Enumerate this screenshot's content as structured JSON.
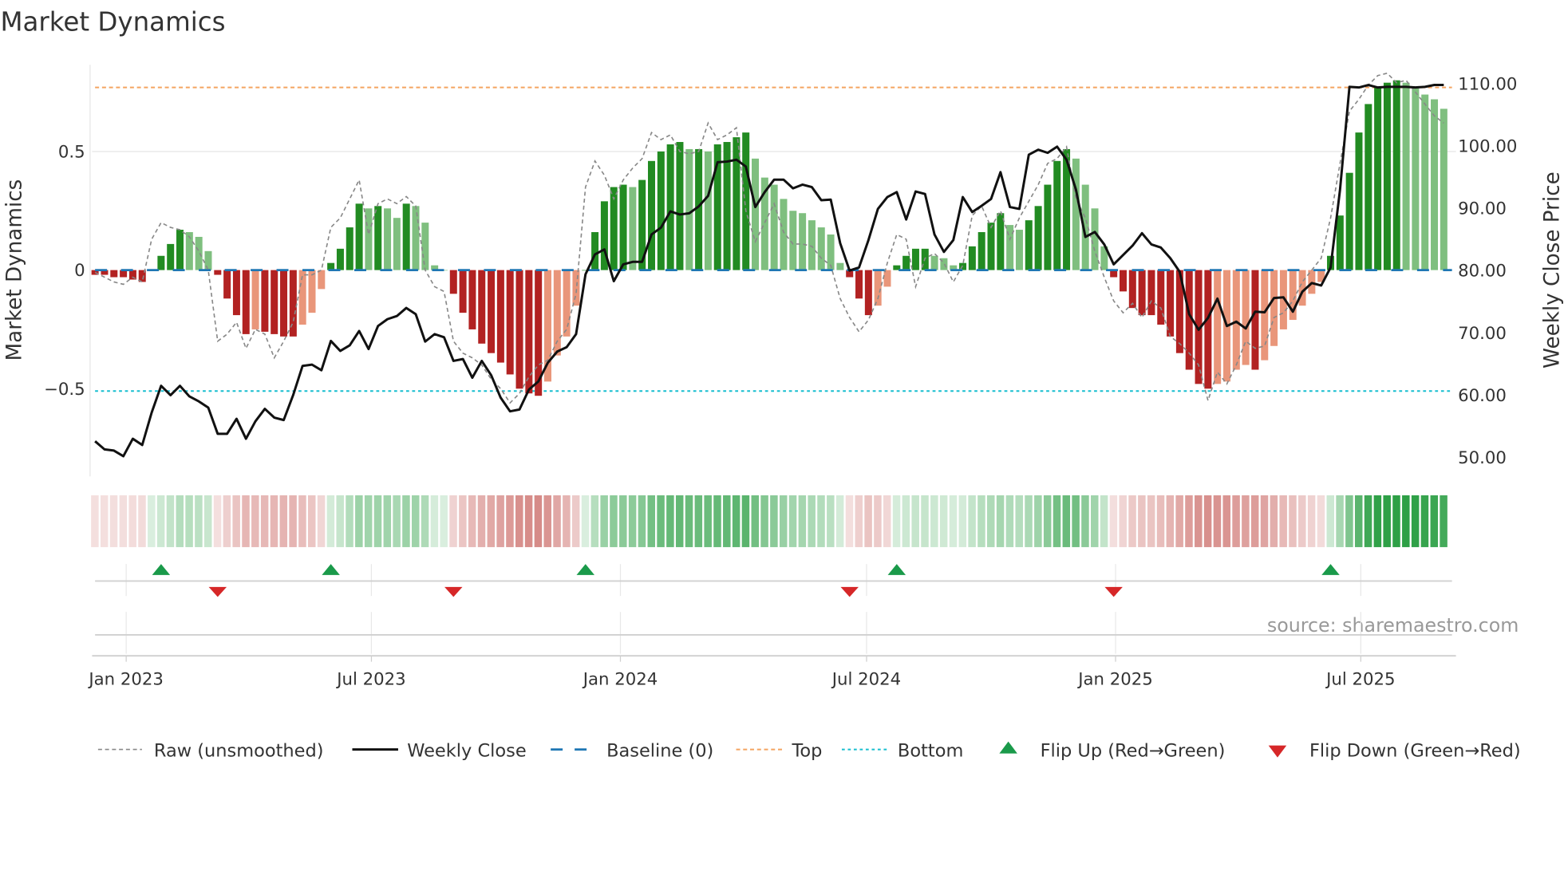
{
  "chart_data": {
    "type": "bar",
    "title": "Market Dynamics",
    "ylabel": "Market Dynamics",
    "y2label": "Weekly Close Price",
    "ylim": [
      -0.87,
      0.87
    ],
    "y2lim": [
      45,
      114
    ],
    "yticks": [
      {
        "v": 0.5,
        "label": "0.5"
      },
      {
        "v": 0,
        "label": "0"
      },
      {
        "v": -0.5,
        "label": "−0.5"
      }
    ],
    "y2ticks": [
      {
        "v": 110,
        "label": "110.00"
      },
      {
        "v": 100,
        "label": "100.00"
      },
      {
        "v": 90,
        "label": "90.00"
      },
      {
        "v": 80,
        "label": "80.00"
      },
      {
        "v": 70,
        "label": "70.00"
      },
      {
        "v": 60,
        "label": "60.00"
      },
      {
        "v": 50,
        "label": "50.00"
      }
    ],
    "xticks": [
      {
        "week": 3.3,
        "label": "Jan 2023"
      },
      {
        "week": 29.3,
        "label": "Jul 2023"
      },
      {
        "week": 55.7,
        "label": "Jan 2024"
      },
      {
        "week": 81.8,
        "label": "Jul 2024"
      },
      {
        "week": 108.2,
        "label": "Jan 2025"
      },
      {
        "week": 134.2,
        "label": "Jul 2025"
      }
    ],
    "top": 0.77,
    "bottom": -0.51,
    "momentum": [
      -0.02,
      -0.02,
      -0.03,
      -0.03,
      -0.04,
      -0.05,
      0.0,
      0.06,
      0.11,
      0.17,
      0.16,
      0.14,
      0.08,
      -0.02,
      -0.12,
      -0.19,
      -0.27,
      -0.25,
      -0.26,
      -0.27,
      -0.28,
      -0.28,
      -0.23,
      -0.18,
      -0.08,
      0.03,
      0.09,
      0.18,
      0.28,
      0.26,
      0.27,
      0.26,
      0.22,
      0.28,
      0.27,
      0.2,
      0.02,
      0.0,
      -0.1,
      -0.18,
      -0.25,
      -0.31,
      -0.35,
      -0.39,
      -0.44,
      -0.5,
      -0.52,
      -0.53,
      -0.47,
      -0.36,
      -0.28,
      -0.15,
      0.0,
      0.16,
      0.29,
      0.35,
      0.36,
      0.35,
      0.38,
      0.46,
      0.5,
      0.53,
      0.54,
      0.51,
      0.51,
      0.5,
      0.53,
      0.54,
      0.56,
      0.58,
      0.47,
      0.39,
      0.36,
      0.3,
      0.25,
      0.24,
      0.21,
      0.18,
      0.15,
      0.03,
      -0.03,
      -0.12,
      -0.19,
      -0.15,
      -0.07,
      0.02,
      0.06,
      0.09,
      0.09,
      0.06,
      0.05,
      0.02,
      0.03,
      0.1,
      0.16,
      0.2,
      0.24,
      0.19,
      0.17,
      0.21,
      0.27,
      0.36,
      0.46,
      0.51,
      0.47,
      0.36,
      0.26,
      0.1,
      -0.03,
      -0.09,
      -0.16,
      -0.19,
      -0.19,
      -0.23,
      -0.28,
      -0.35,
      -0.42,
      -0.48,
      -0.5,
      -0.48,
      -0.47,
      -0.42,
      -0.4,
      -0.42,
      -0.38,
      -0.32,
      -0.25,
      -0.21,
      -0.15,
      -0.1,
      -0.05,
      0.06,
      0.23,
      0.41,
      0.58,
      0.7,
      0.77,
      0.79,
      0.8,
      0.79,
      0.77,
      0.74,
      0.72,
      0.68
    ],
    "raw": [
      -0.01,
      -0.03,
      -0.05,
      -0.06,
      -0.03,
      -0.05,
      0.13,
      0.2,
      0.18,
      0.17,
      0.14,
      0.08,
      0.0,
      -0.3,
      -0.27,
      -0.22,
      -0.33,
      -0.25,
      -0.27,
      -0.37,
      -0.3,
      -0.22,
      -0.02,
      -0.02,
      0.0,
      0.18,
      0.22,
      0.3,
      0.38,
      0.15,
      0.28,
      0.3,
      0.28,
      0.31,
      0.27,
      0.0,
      -0.07,
      -0.09,
      -0.3,
      -0.35,
      -0.37,
      -0.4,
      -0.46,
      -0.5,
      -0.56,
      -0.52,
      -0.45,
      -0.4,
      -0.38,
      -0.3,
      -0.25,
      -0.1,
      0.35,
      0.46,
      0.4,
      0.3,
      0.38,
      0.43,
      0.47,
      0.58,
      0.55,
      0.57,
      0.5,
      0.49,
      0.5,
      0.62,
      0.55,
      0.57,
      0.6,
      0.25,
      0.12,
      0.2,
      0.28,
      0.16,
      0.11,
      0.11,
      0.1,
      0.05,
      0.02,
      -0.12,
      -0.2,
      -0.26,
      -0.21,
      -0.12,
      0.03,
      0.15,
      0.13,
      -0.07,
      0.05,
      0.07,
      0.03,
      -0.05,
      0.02,
      0.23,
      0.27,
      0.18,
      0.25,
      0.13,
      0.22,
      0.29,
      0.36,
      0.45,
      0.47,
      0.52,
      0.3,
      0.22,
      0.08,
      -0.03,
      -0.13,
      -0.18,
      -0.14,
      -0.2,
      -0.13,
      -0.16,
      -0.28,
      -0.31,
      -0.35,
      -0.4,
      -0.55,
      -0.43,
      -0.48,
      -0.4,
      -0.3,
      -0.33,
      -0.32,
      -0.2,
      -0.18,
      -0.13,
      -0.05,
      0.0,
      0.05,
      0.22,
      0.45,
      0.67,
      0.72,
      0.78,
      0.82,
      0.83,
      0.79,
      0.8,
      0.75,
      0.7,
      0.65,
      0.62
    ],
    "close": [
      52.6,
      51.3,
      51.1,
      50.2,
      53,
      52,
      57.2,
      61.5,
      60,
      61.5,
      59.8,
      59,
      58,
      53.8,
      53.8,
      56.2,
      53,
      55.8,
      57.8,
      56.4,
      56,
      60,
      64.7,
      64.9,
      64,
      68.7,
      67.1,
      68,
      70.3,
      67.4,
      71.1,
      72.2,
      72.7,
      74,
      73,
      68.6,
      69.8,
      69.3,
      65.5,
      65.8,
      62.8,
      65.5,
      63.2,
      59.6,
      57.4,
      57.7,
      60.9,
      62.2,
      65.2,
      67,
      67.7,
      69.8,
      79.4,
      82.6,
      83.4,
      78.3,
      81,
      81.4,
      81.4,
      85.8,
      86.9,
      89.5,
      89,
      89.2,
      90.3,
      92,
      97.4,
      97.5,
      97.8,
      96.7,
      90.2,
      92.6,
      94.6,
      94.6,
      93.2,
      93.8,
      93.4,
      91.3,
      91.4,
      84.4,
      80,
      80.5,
      84.9,
      89.9,
      91.8,
      92.6,
      88.2,
      92.7,
      92.3,
      85.8,
      83,
      84.9,
      91.8,
      89.4,
      90.4,
      91.5,
      95.8,
      90.2,
      89.9,
      98.6,
      99.4,
      98.9,
      99.9,
      97.8,
      93,
      85.4,
      86.2,
      84.2,
      81,
      82.5,
      84,
      86,
      84.2,
      83.7,
      82,
      79.8,
      73,
      70.5,
      72.4,
      75.5,
      71.1,
      71.8,
      70.7,
      73.4,
      73.3,
      75.6,
      75.7,
      73.4,
      76.6,
      78,
      77.6,
      80.5,
      93,
      109.5,
      109.4,
      109.8,
      109.4,
      109.5,
      109.5,
      109.5,
      109.4,
      109.5,
      109.8,
      109.8
    ],
    "flip_up_weeks": [
      7,
      25,
      52,
      85,
      131
    ],
    "flip_down_weeks": [
      13,
      38,
      80,
      108
    ],
    "legend": [
      "Raw (unsmoothed)",
      "Weekly Close",
      "Baseline (0)",
      "Top",
      "Bottom",
      "Flip Up (Red→Green)",
      "Flip Down (Green→Red)"
    ],
    "source": "source: sharemaestro.com"
  },
  "colors": {
    "pos_strong": "#228b22",
    "pos_weak": "#7fbf7f",
    "neg_strong": "#b22222",
    "neg_weak": "#e9967a",
    "top": "#f4a460",
    "bottom": "#17becf",
    "baseline": "#1f77b4",
    "flip_up": "#1a9a4a",
    "flip_down": "#d62728"
  }
}
